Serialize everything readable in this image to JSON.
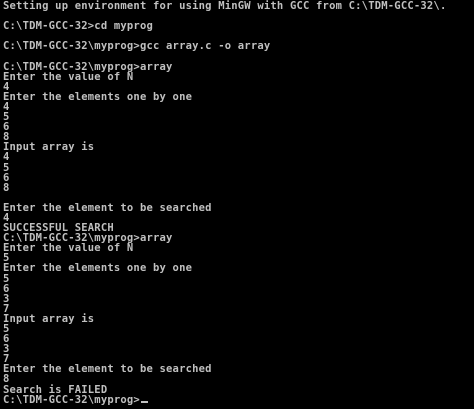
{
  "console": {
    "lines": [
      "Setting up environment for using MinGW with GCC from C:\\TDM-GCC-32\\.",
      "",
      "C:\\TDM-GCC-32>cd myprog",
      "",
      "C:\\TDM-GCC-32\\myprog>gcc array.c -o array",
      "",
      "C:\\TDM-GCC-32\\myprog>array",
      "Enter the value of N",
      "4",
      "Enter the elements one by one",
      "4",
      "5",
      "6",
      "8",
      "Input array is",
      "4",
      "5",
      "6",
      "8",
      "Enter the element to be searched",
      "4",
      "SUCCESSFUL SEARCH",
      "C:\\TDM-GCC-32\\myprog>array",
      "Enter the value of N",
      "5",
      "Enter the elements one by one",
      "5",
      "6",
      "3",
      "7",
      "Input array is",
      "5",
      "6",
      "3",
      "7",
      "Enter the element to be searched",
      "8",
      "Search is FAILED",
      "C:\\TDM-GCC-32\\myprog>"
    ]
  },
  "colors": {
    "background": "#000000",
    "text": "#c0c0c0"
  }
}
